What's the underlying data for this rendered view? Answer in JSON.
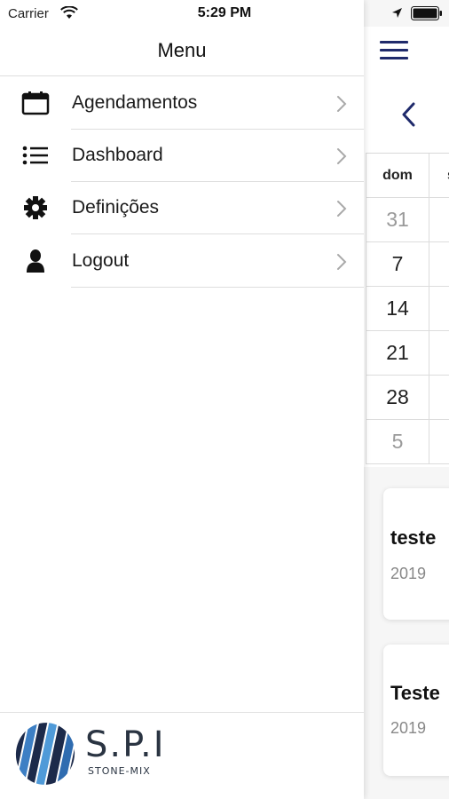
{
  "status_bar": {
    "carrier": "Carrier",
    "time": "5:29 PM"
  },
  "menu": {
    "title": "Menu",
    "items": [
      {
        "label": "Agendamentos",
        "icon": "calendar-icon"
      },
      {
        "label": "Dashboard",
        "icon": "list-icon"
      },
      {
        "label": "Definições",
        "icon": "gear-icon"
      },
      {
        "label": "Logout",
        "icon": "user-icon"
      }
    ]
  },
  "logo": {
    "text": "S.P.I",
    "subtext": "STONE-MIX"
  },
  "background_screen": {
    "calendar": {
      "day_headers": [
        "dom",
        "s"
      ],
      "days": [
        "31",
        "7",
        "14",
        "21",
        "28",
        "5"
      ]
    },
    "events": [
      {
        "title": "teste",
        "date": "2019"
      },
      {
        "title": "Teste",
        "date": "2019"
      }
    ]
  },
  "colors": {
    "accent": "#1f2a6b",
    "separator": "#dedede"
  }
}
